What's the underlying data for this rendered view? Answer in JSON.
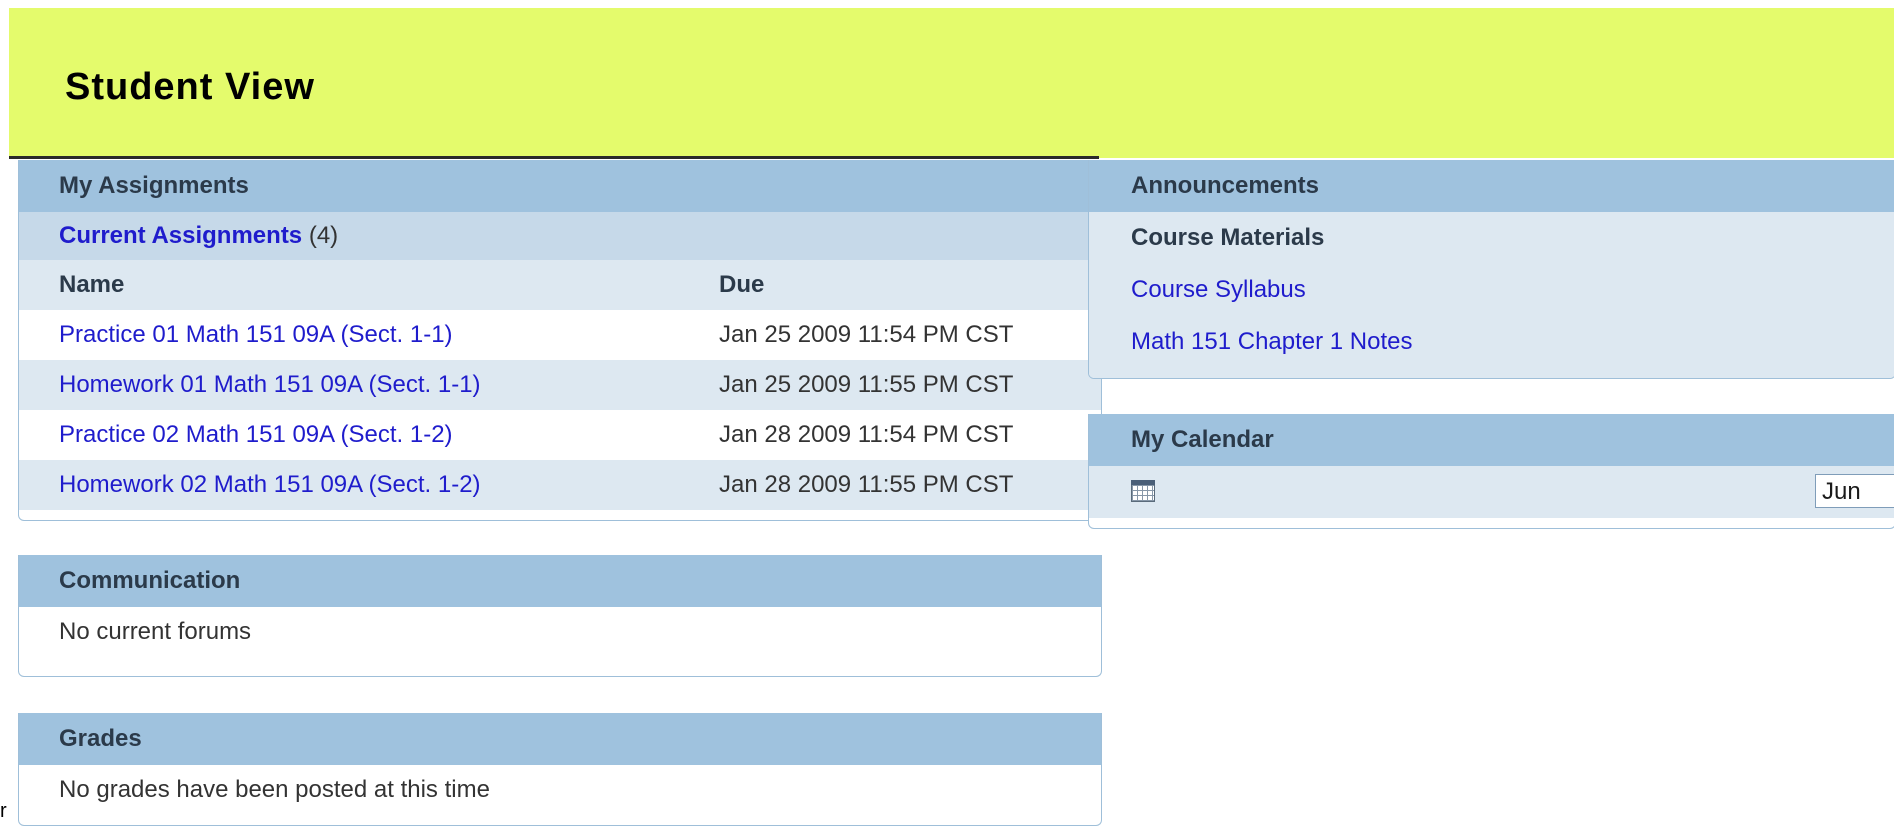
{
  "banner": {
    "title": "Student View"
  },
  "assignments": {
    "header": "My Assignments",
    "current_label": "Current Assignments",
    "current_count": "(4)",
    "columns": [
      "Name",
      "Due"
    ],
    "rows": [
      {
        "name": "Practice 01 Math 151 09A (Sect. 1-1)",
        "due": "Jan 25 2009 11:54 PM CST"
      },
      {
        "name": "Homework 01 Math 151 09A (Sect. 1-1)",
        "due": "Jan 25 2009 11:55 PM CST"
      },
      {
        "name": "Practice 02 Math 151 09A (Sect. 1-2)",
        "due": "Jan 28 2009 11:54 PM CST"
      },
      {
        "name": "Homework 02 Math 151 09A (Sect. 1-2)",
        "due": "Jan 28 2009 11:55 PM CST"
      }
    ]
  },
  "communication": {
    "header": "Communication",
    "message": "No current forums"
  },
  "grades": {
    "header": "Grades",
    "message": "No grades have been posted at this time"
  },
  "announcements": {
    "header": "Announcements",
    "section_title": "Course Materials",
    "links": [
      "Course Syllabus",
      "Math 151 Chapter 1 Notes"
    ]
  },
  "calendar": {
    "header": "My Calendar",
    "icon": "calendar-icon",
    "month_select_value": "Jun"
  },
  "edge_fragment": "r",
  "colors": {
    "banner": "#e4fb6c",
    "panel_header": "#9fc2de",
    "sub_header": "#c6d9e9",
    "row_alt": "#dde8f1",
    "link": "#1f1ccc"
  }
}
